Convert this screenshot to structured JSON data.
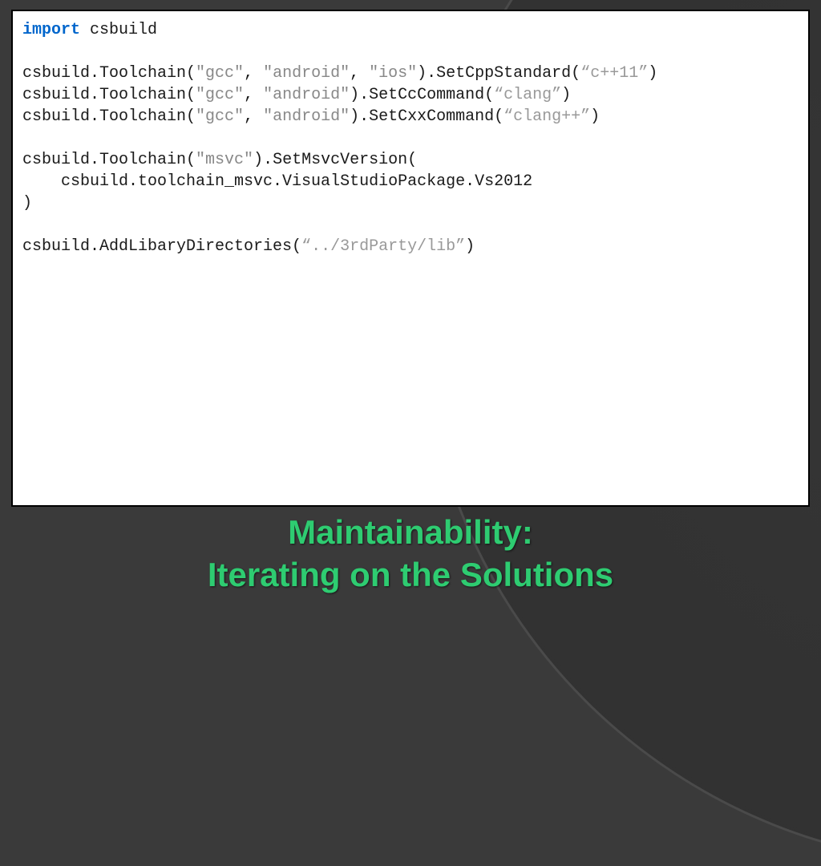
{
  "code": {
    "l1_kw": "import",
    "l1_rest": " csbuild",
    "l3_a": "csbuild.Toolchain(",
    "l3_s1": "\"gcc\"",
    "l3_b": ", ",
    "l3_s2": "\"android\"",
    "l3_c": ", ",
    "l3_s3": "\"ios\"",
    "l3_d": ").SetCppStandard(",
    "l3_s4": "“c++11”",
    "l3_e": ")",
    "l4_a": "csbuild.Toolchain(",
    "l4_s1": "\"gcc\"",
    "l4_b": ", ",
    "l4_s2": "\"android\"",
    "l4_c": ").SetCcCommand(",
    "l4_s3": "“clang”",
    "l4_d": ")",
    "l5_a": "csbuild.Toolchain(",
    "l5_s1": "\"gcc\"",
    "l5_b": ", ",
    "l5_s2": "\"android\"",
    "l5_c": ").SetCxxCommand(",
    "l5_s3": "“clang++”",
    "l5_d": ")",
    "l7_a": "csbuild.Toolchain(",
    "l7_s1": "\"msvc\"",
    "l7_b": ").SetMsvcVersion(",
    "l8": "    csbuild.toolchain_msvc.VisualStudioPackage.Vs2012",
    "l9": ")",
    "l11_a": "csbuild.AddLibaryDirectories(",
    "l11_s1": "“../3rdParty/lib”",
    "l11_b": ")"
  },
  "title": {
    "line1": "Maintainability:",
    "line2": "Iterating on the Solutions"
  }
}
